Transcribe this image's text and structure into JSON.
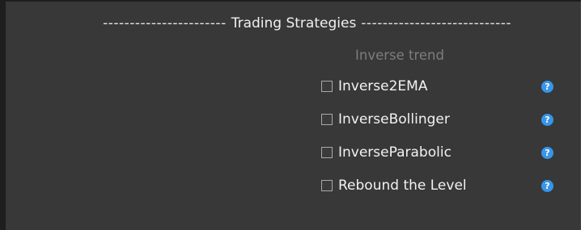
{
  "section": {
    "title": "Trading Strategies",
    "dashes_left": "-----------------------",
    "dashes_right": "----------------------------"
  },
  "group": {
    "title": "Inverse trend"
  },
  "strategies": [
    {
      "label": "Inverse2EMA",
      "checked": false,
      "help_icon": "?"
    },
    {
      "label": "InverseBollinger",
      "checked": false,
      "help_icon": "?"
    },
    {
      "label": "InverseParabolic",
      "checked": false,
      "help_icon": "?"
    },
    {
      "label": "Rebound the Level",
      "checked": false,
      "help_icon": "?"
    }
  ],
  "colors": {
    "panel_background": "#383838",
    "help_icon": "#3796e8",
    "group_title": "#7d7d7d"
  }
}
